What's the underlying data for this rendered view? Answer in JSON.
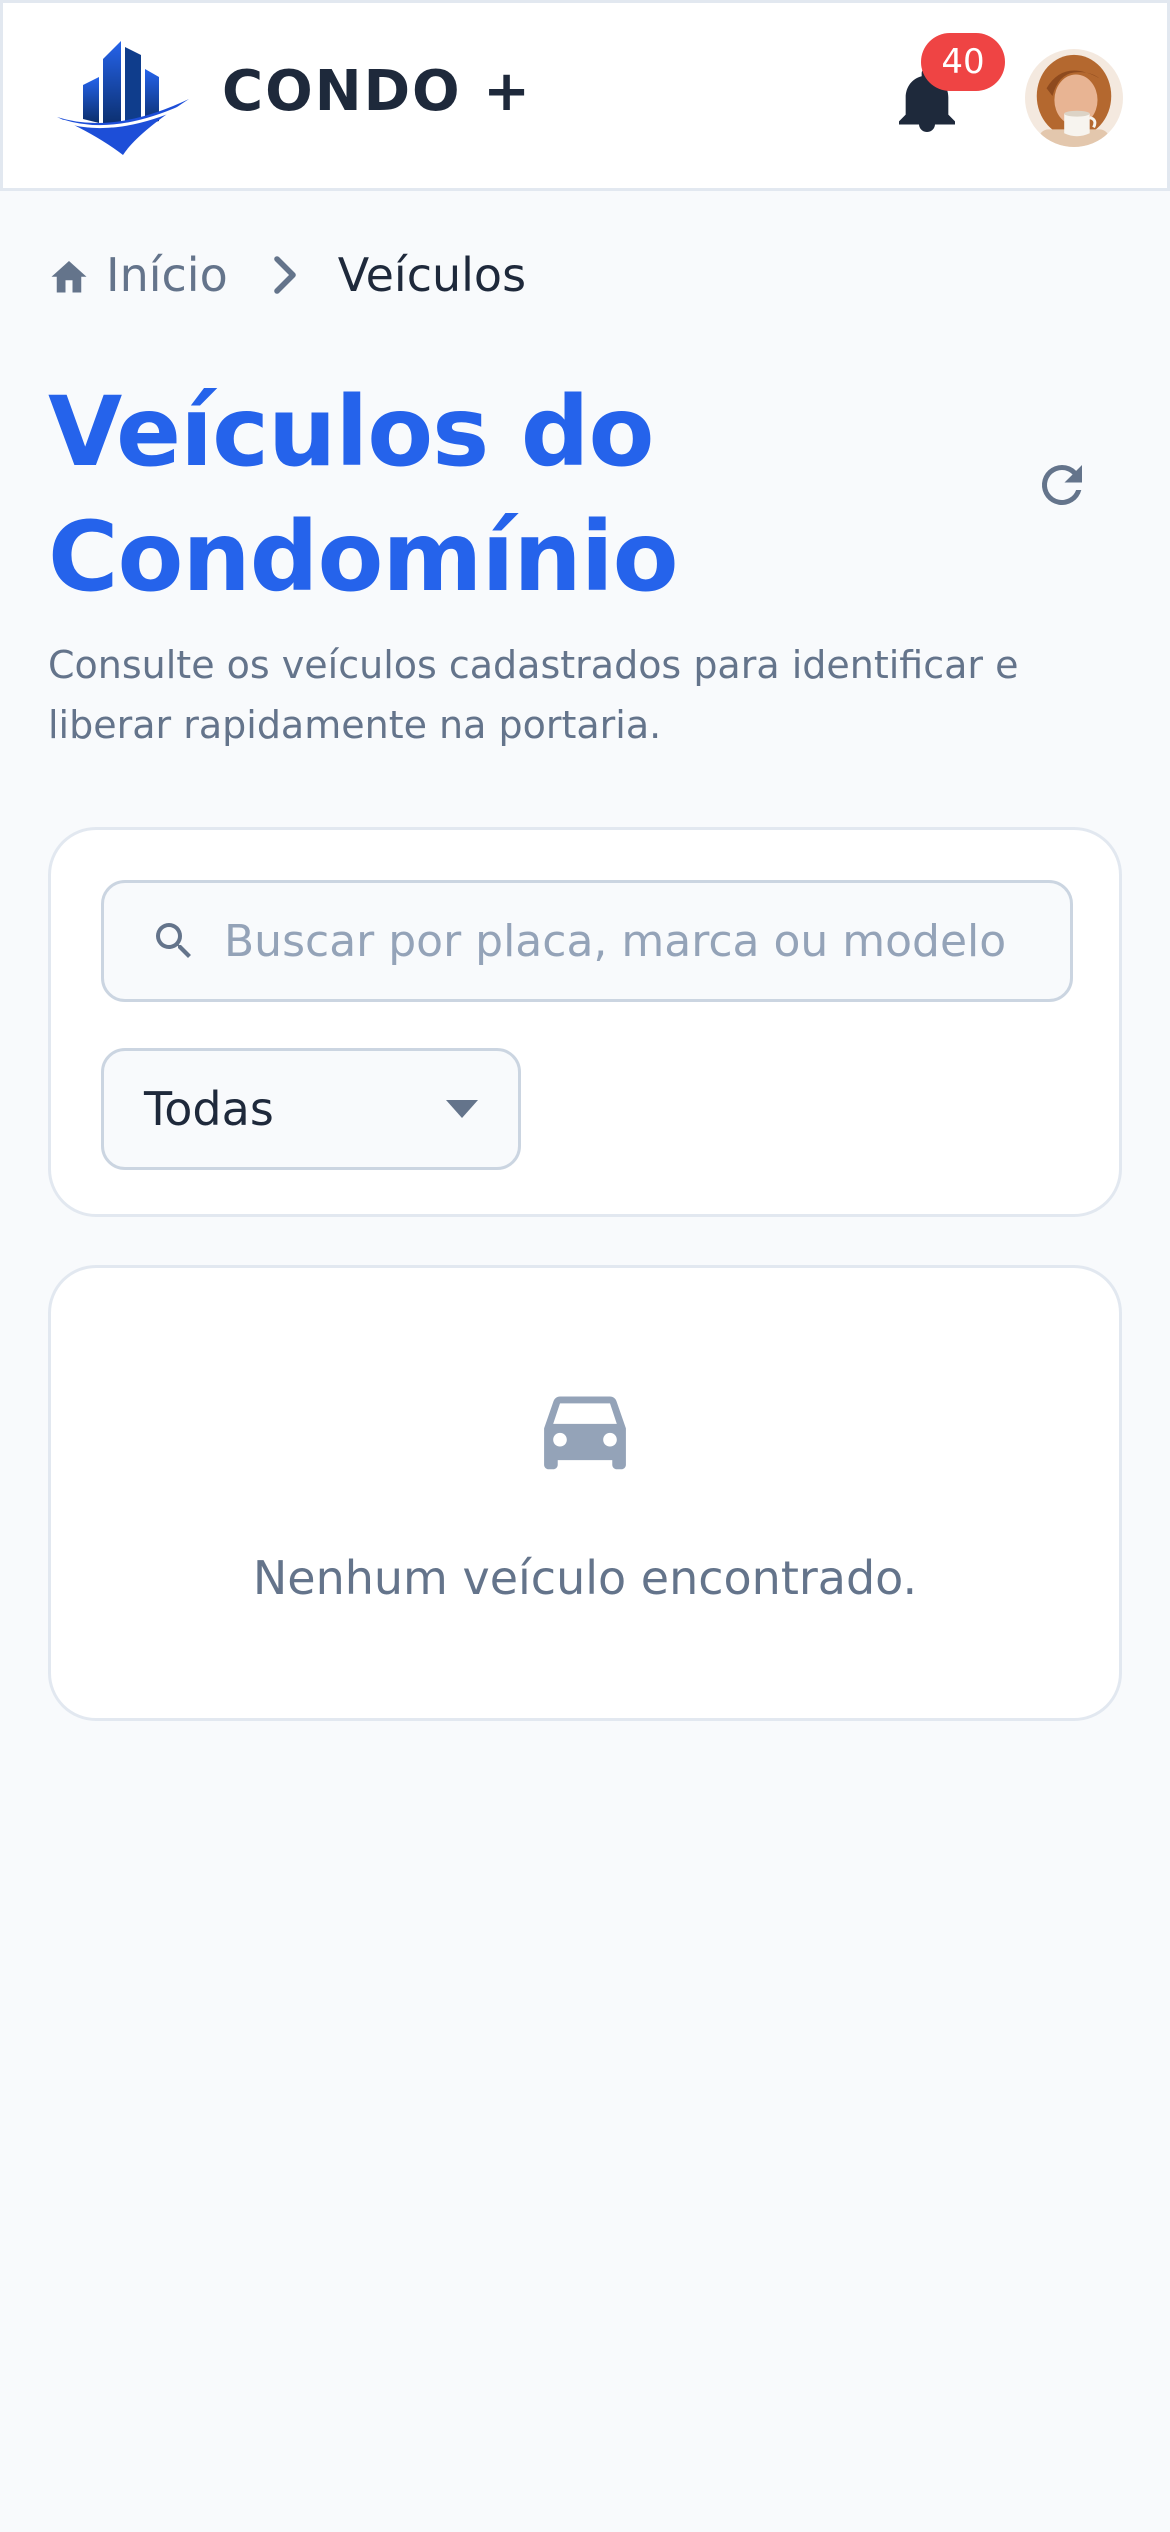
{
  "header": {
    "brand": "CONDO +",
    "notifications_count": "40"
  },
  "breadcrumb": {
    "home": "Início",
    "current": "Veículos"
  },
  "page": {
    "title": "Veículos do Condomínio",
    "subtitle": "Consulte os veículos cadastrados para identificar e liberar rapidamente na portaria."
  },
  "filters": {
    "search_placeholder": "Buscar por placa, marca ou modelo",
    "search_value": "",
    "select_value": "Todas"
  },
  "empty_state": {
    "message": "Nenhum veículo encontrado.",
    "icon": "car-icon"
  },
  "colors": {
    "accent": "#2563eb",
    "badge": "#ef4444",
    "muted": "#64748b",
    "background": "#f8fafc"
  }
}
